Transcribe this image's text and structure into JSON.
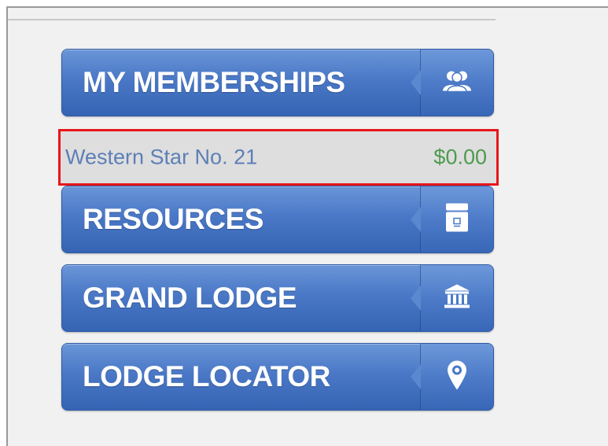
{
  "nav": {
    "memberships": {
      "label": "MY MEMBERSHIPS",
      "icon": "users-icon"
    },
    "resources": {
      "label": "RESOURCES",
      "icon": "archive-box-icon"
    },
    "grand_lodge": {
      "label": "GRAND LODGE",
      "icon": "temple-icon"
    },
    "lodge_locator": {
      "label": "LODGE LOCATOR",
      "icon": "map-pin-icon"
    }
  },
  "membership_entry": {
    "name": "Western Star No. 21",
    "balance": "$0.00"
  },
  "colors": {
    "button_blue": "#4a78c6",
    "highlight_red": "#e8161b",
    "balance_green": "#4e9a4e",
    "name_blue": "#5d7fb6"
  }
}
